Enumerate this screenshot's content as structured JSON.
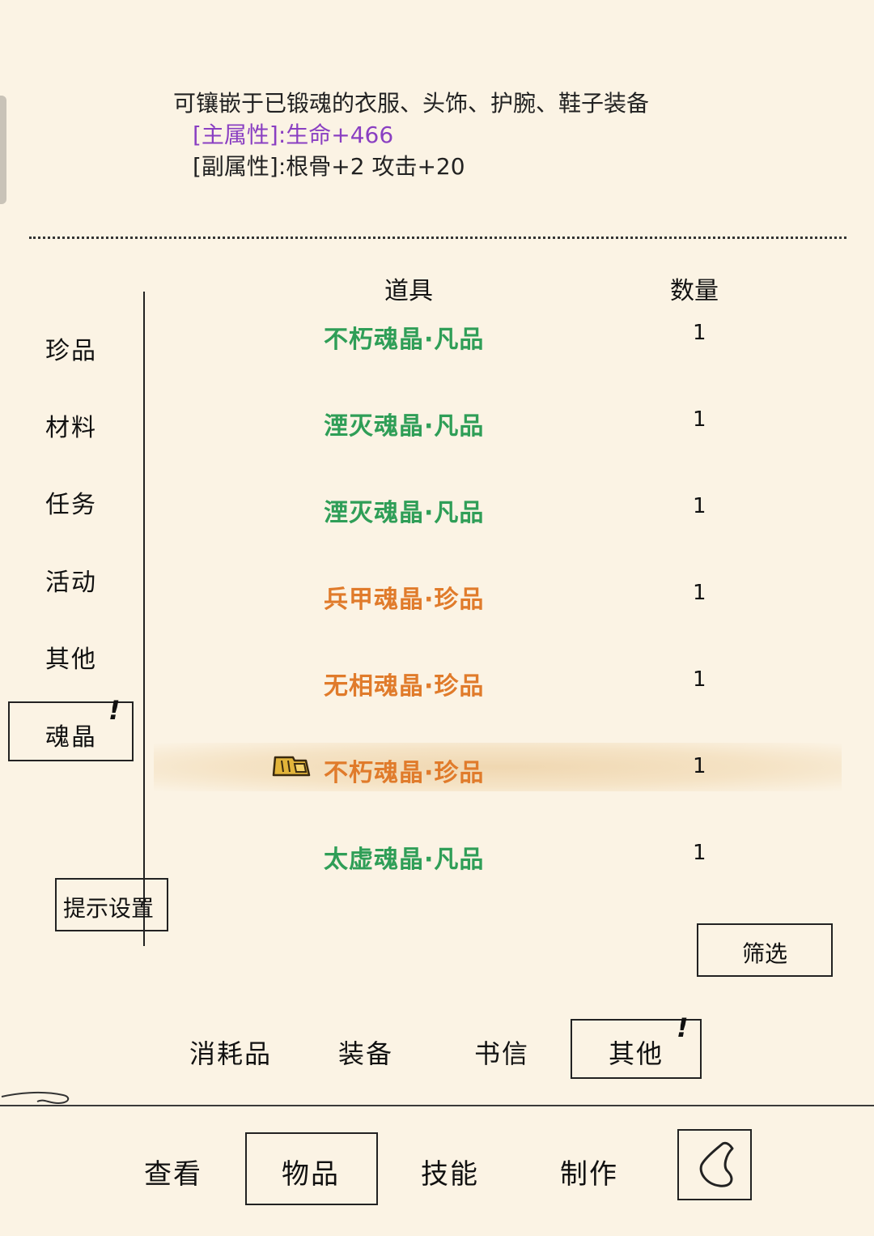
{
  "description": {
    "line1": "可镶嵌于已锻魂的衣服、头饰、护腕、鞋子装备",
    "main_attr": "[主属性]:生命+466",
    "sub_attr": "[副属性]:根骨+2 攻击+20"
  },
  "table": {
    "header_item": "道具",
    "header_qty": "数量",
    "rows": [
      {
        "name": "不朽魂晶·凡品",
        "qty": "1",
        "color": "#2f9e57"
      },
      {
        "name": "湮灭魂晶·凡品",
        "qty": "1",
        "color": "#2f9e57"
      },
      {
        "name": "湮灭魂晶·凡品",
        "qty": "1",
        "color": "#2f9e57"
      },
      {
        "name": "兵甲魂晶·珍品",
        "qty": "1",
        "color": "#e07b2b"
      },
      {
        "name": "无相魂晶·珍品",
        "qty": "1",
        "color": "#e07b2b"
      },
      {
        "name": "不朽魂晶·珍品",
        "qty": "1",
        "color": "#e07b2b"
      },
      {
        "name": "太虚魂晶·凡品",
        "qty": "1",
        "color": "#2f9e57"
      }
    ]
  },
  "categories": [
    "珍品",
    "材料",
    "任务",
    "活动",
    "其他",
    "魂晶"
  ],
  "alert_mark": "!",
  "buttons": {
    "hint_settings": "提示设置",
    "filter": "筛选"
  },
  "tabs": [
    "消耗品",
    "装备",
    "书信",
    "其他"
  ],
  "nav": [
    "查看",
    "物品",
    "技能",
    "制作"
  ],
  "icons": {
    "lock": "lock-icon",
    "back": "back-icon"
  }
}
